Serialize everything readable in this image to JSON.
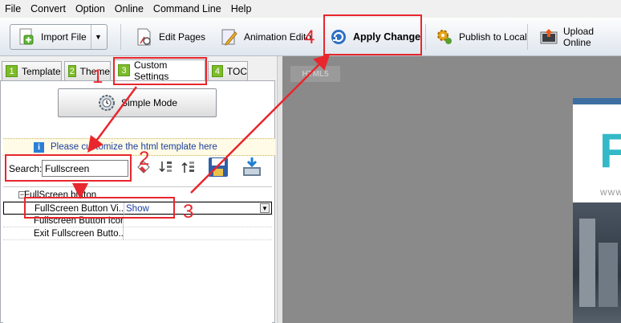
{
  "menu": [
    "File",
    "Convert",
    "Option",
    "Online",
    "Command Line",
    "Help"
  ],
  "toolbar": {
    "import_file": "Import File",
    "edit_pages": "Edit Pages",
    "animation_editor": "Animation Edito",
    "apply_change": "Apply Change",
    "publish_local": "Publish to Local",
    "upload_online": "Upload Online"
  },
  "tabs": [
    {
      "num": "1",
      "label": "Template"
    },
    {
      "num": "2",
      "label": "Theme"
    },
    {
      "num": "3",
      "label": "Custom Settings"
    },
    {
      "num": "4",
      "label": "TOC"
    }
  ],
  "simple_mode": "Simple Mode",
  "info_text": "Please customize the html template here",
  "search": {
    "label": "Search:",
    "value": "Fullscreen"
  },
  "grid": {
    "group": "FullScreen button",
    "rows": [
      {
        "name": "FullScreen Button Vi...",
        "value": "Show"
      },
      {
        "name": "Fullscreen Button Icon",
        "value": ""
      },
      {
        "name": "Exit Fullscreen Butto...",
        "value": ""
      }
    ]
  },
  "preview": {
    "badge": "HTML5",
    "book_letter": "F",
    "book_www": "www"
  },
  "annotations": [
    "1",
    "2",
    "3",
    "4"
  ],
  "colors": {
    "annotation": "#e8262d",
    "tab_number": "#7cbb2a",
    "info_text": "#1b3d9e",
    "preview_bg": "#8a8a8a"
  }
}
